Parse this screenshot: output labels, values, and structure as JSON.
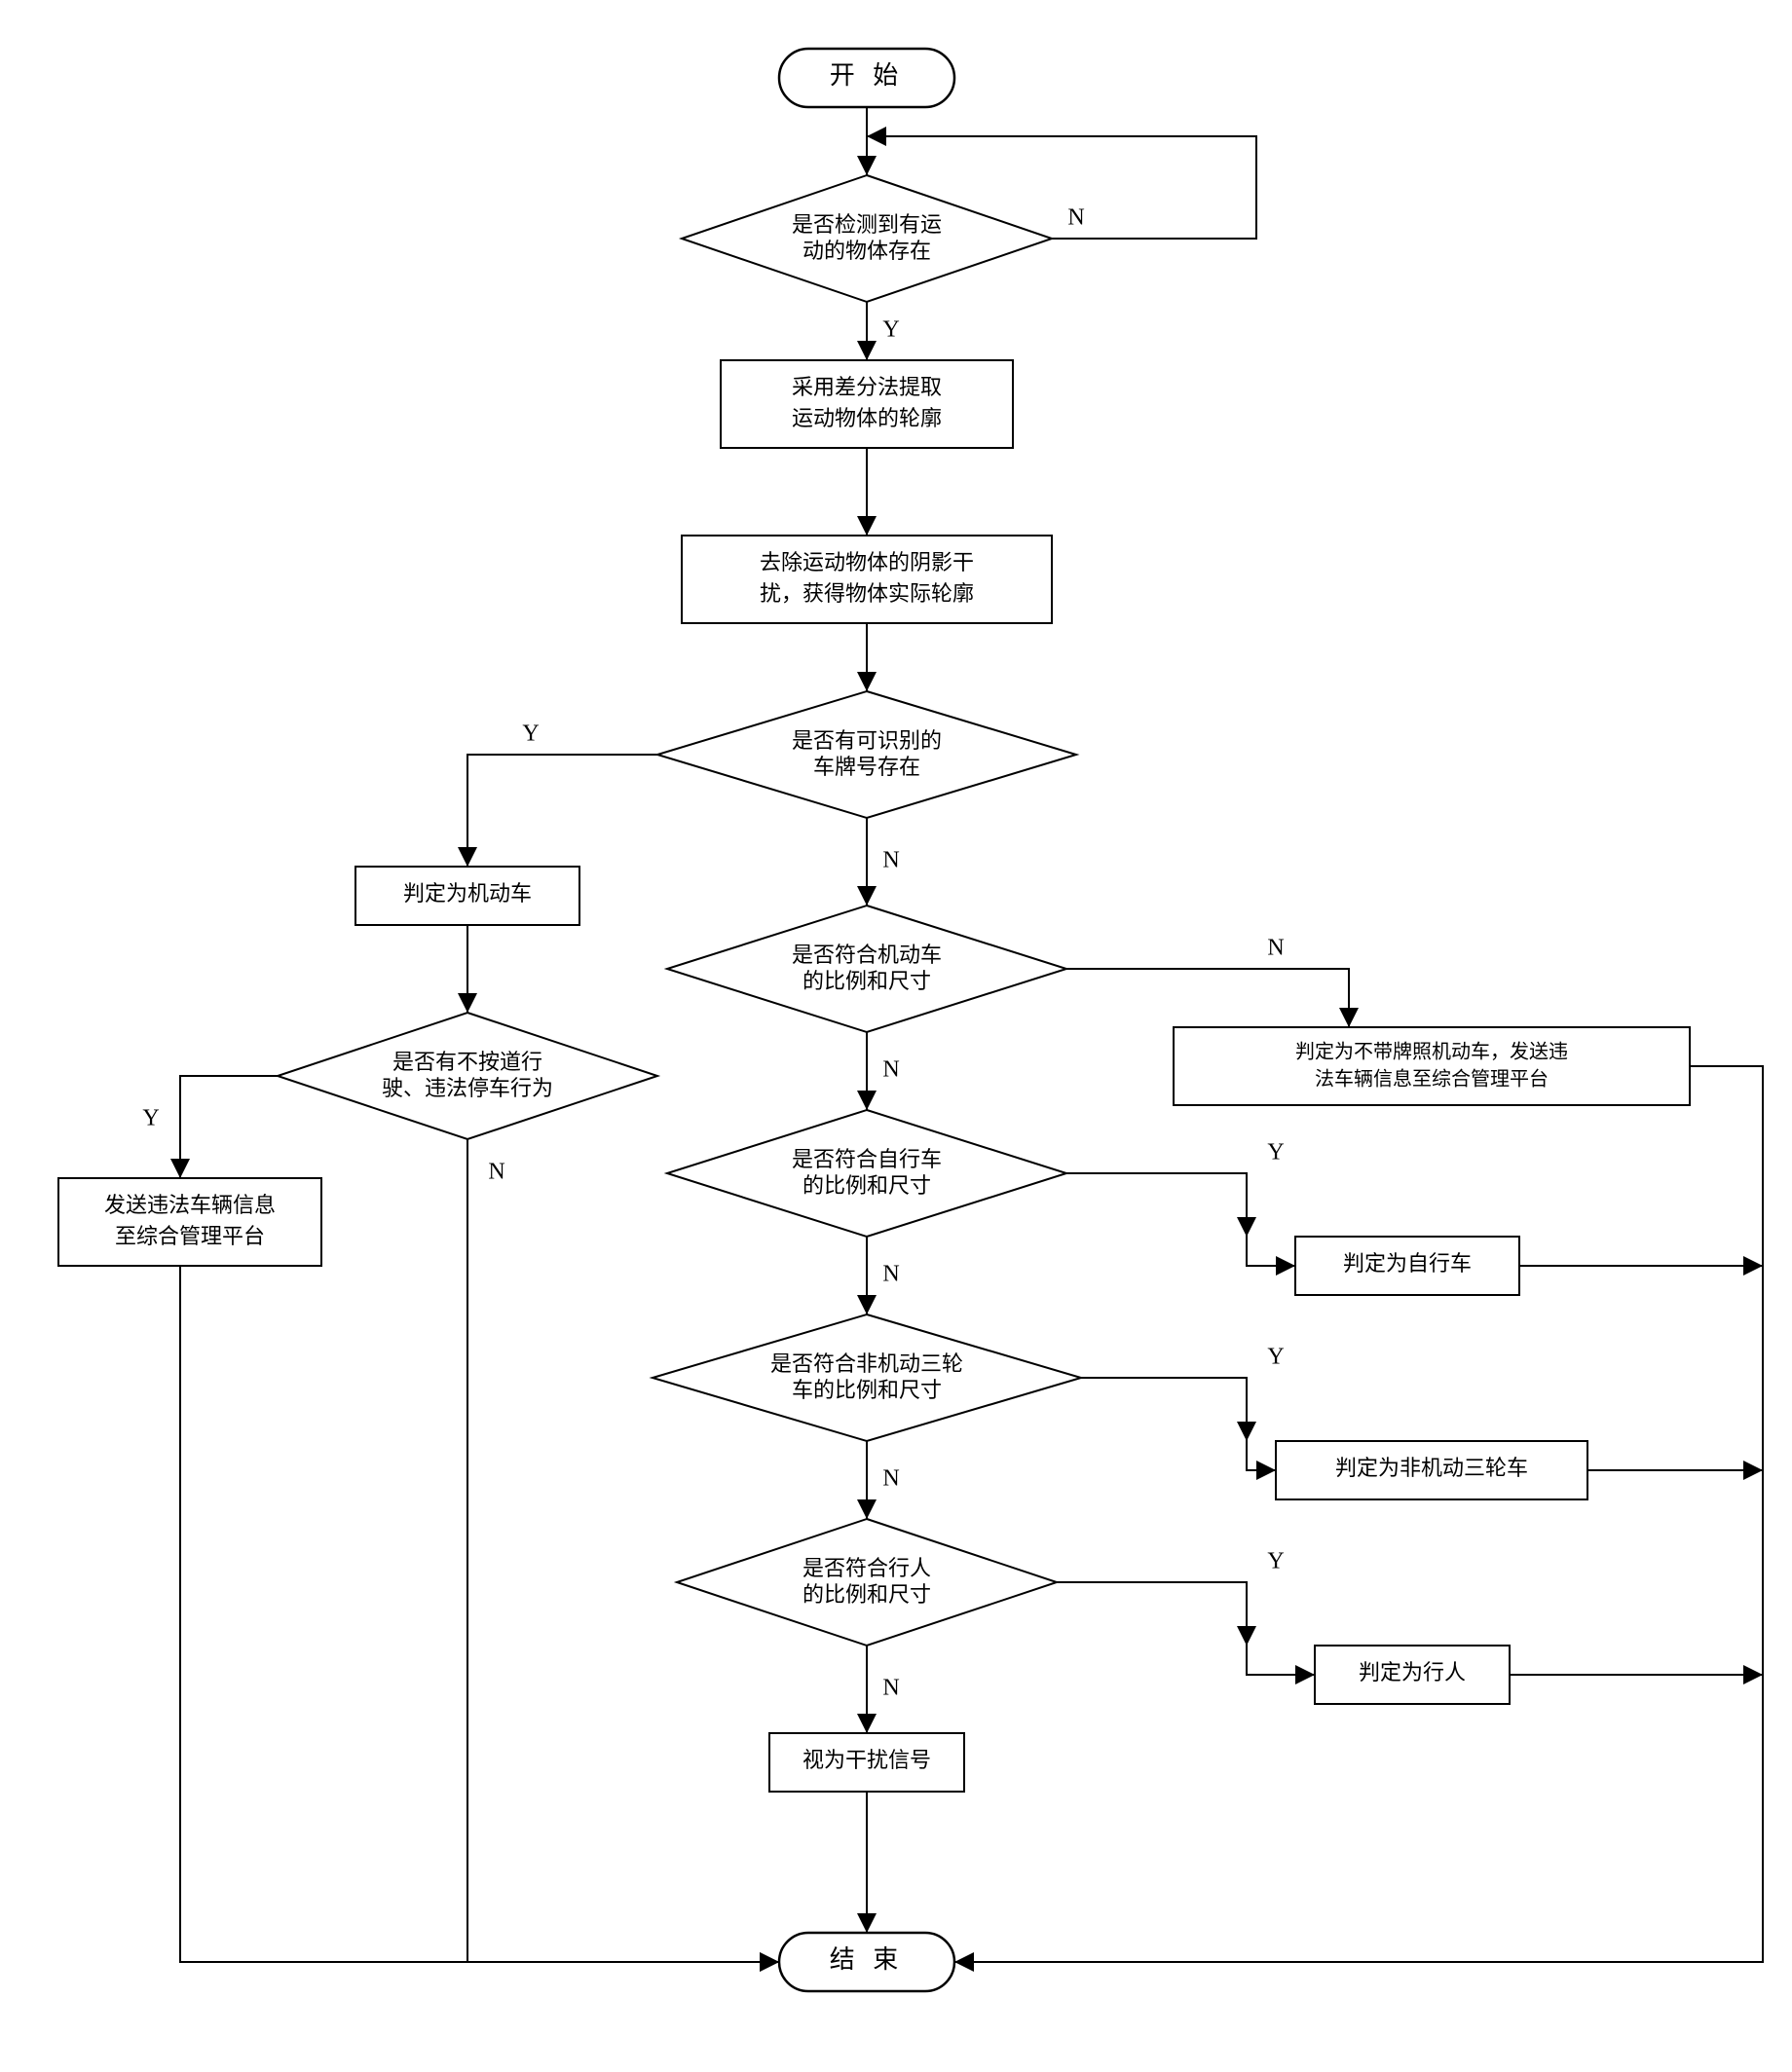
{
  "nodes": {
    "start": "开 始",
    "end": "结 束",
    "d_motion": {
      "l1": "是否检测到有运",
      "l2": "动的物体存在"
    },
    "p_diff": {
      "l1": "采用差分法提取",
      "l2": "运动物体的轮廓"
    },
    "p_shadow": {
      "l1": "去除运动物体的阴影干",
      "l2": "扰，获得物体实际轮廓"
    },
    "d_plate": {
      "l1": "是否有可识别的",
      "l2": "车牌号存在"
    },
    "p_motor": "判定为机动车",
    "d_illegal": {
      "l1": "是否有不按道行",
      "l2": "驶、违法停车行为"
    },
    "p_send": {
      "l1": "发送违法车辆信息",
      "l2": "至综合管理平台"
    },
    "d_motor_size": {
      "l1": "是否符合机动车",
      "l2": "的比例和尺寸"
    },
    "p_noplate": {
      "l1": "判定为不带牌照机动车，发送违",
      "l2": "法车辆信息至综合管理平台"
    },
    "d_bike": {
      "l1": "是否符合自行车",
      "l2": "的比例和尺寸"
    },
    "p_bike": "判定为自行车",
    "d_tricycle": {
      "l1": "是否符合非机动三轮",
      "l2": "车的比例和尺寸"
    },
    "p_tricycle": "判定为非机动三轮车",
    "d_ped": {
      "l1": "是否符合行人",
      "l2": "的比例和尺寸"
    },
    "p_ped": "判定为行人",
    "p_noise": "视为干扰信号"
  },
  "labels": {
    "Y": "Y",
    "N": "N"
  }
}
